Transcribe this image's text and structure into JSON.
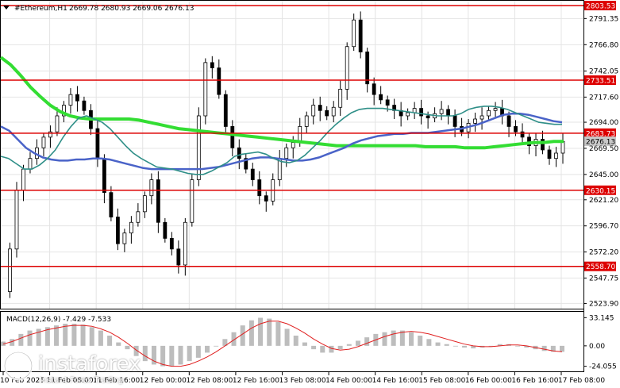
{
  "header": {
    "symbol": "#Ethereum,H1",
    "ohlc": "2669.78 2680.93 2669.06 2676.13"
  },
  "macd": {
    "label": "MACD(12,26,9) -7.429 -7.533",
    "ticks": [
      "33.145",
      "0.00",
      "-24.055"
    ],
    "tick_values": [
      33.145,
      0.0,
      -24.055
    ],
    "range": [
      -30,
      40
    ]
  },
  "watermark": {
    "brand": "instaforex",
    "tagline": "Instant Forex Trading"
  },
  "colors": {
    "ma_fast": "#2f8f88",
    "ma_mid": "#4a63c8",
    "ma_slow": "#33dd33",
    "level_line": "#dd0000",
    "level_tag": "#dd0000",
    "price_tag": "#c8c8c8",
    "macd_hist": "#bdbdbd",
    "macd_signal": "#e02020"
  },
  "chart_data": {
    "type": "line",
    "series_kind": "candlestick price chart with moving averages",
    "y_ticks": [
      "2791.35",
      "2766.80",
      "2742.05",
      "2717.60",
      "2694.00",
      "2669.50",
      "2645.00",
      "2621.20",
      "2596.70",
      "2572.20",
      "2547.75",
      "2523.90"
    ],
    "y_tick_values": [
      2791.35,
      2766.8,
      2742.05,
      2717.6,
      2694.0,
      2669.5,
      2645.0,
      2621.2,
      2596.7,
      2572.2,
      2547.75,
      2523.9
    ],
    "ylim": [
      2519,
      2808
    ],
    "x_labels": [
      "10 Feb 2025",
      "11 Feb 08:00",
      "11 Feb 16:00",
      "12 Feb 00:00",
      "12 Feb 08:00",
      "12 Feb 16:00",
      "13 Feb 08:00",
      "14 Feb 00:00",
      "14 Feb 16:00",
      "15 Feb 08:00",
      "16 Feb 00:00",
      "16 Feb 16:00",
      "17 Feb 08:00"
    ],
    "levels": [
      {
        "label": "2803.53",
        "value": 2803.53
      },
      {
        "label": "2733.51",
        "value": 2733.51
      },
      {
        "label": "2683.73",
        "value": 2683.73
      },
      {
        "label": "2630.15",
        "value": 2630.15
      },
      {
        "label": "2558.70",
        "value": 2558.7
      }
    ],
    "current_price": {
      "label": "2676.13",
      "value": 2676.13
    },
    "price_path": [
      2535,
      2575,
      2630,
      2650,
      2660,
      2670,
      2680,
      2685,
      2700,
      2710,
      2720,
      2714,
      2705,
      2688,
      2660,
      2628,
      2605,
      2580,
      2590,
      2600,
      2610,
      2625,
      2640,
      2600,
      2585,
      2575,
      2560,
      2600,
      2640,
      2700,
      2750,
      2745,
      2720,
      2690,
      2670,
      2660,
      2650,
      2640,
      2625,
      2620,
      2640,
      2660,
      2670,
      2675,
      2690,
      2700,
      2710,
      2705,
      2700,
      2708,
      2725,
      2765,
      2790,
      2760,
      2730,
      2720,
      2715,
      2710,
      2705,
      2700,
      2703,
      2707,
      2700,
      2698,
      2702,
      2706,
      2700,
      2690,
      2685,
      2693,
      2697,
      2700,
      2705,
      2707,
      2700,
      2690,
      2685,
      2680,
      2672,
      2678,
      2668,
      2660,
      2665,
      2676
    ],
    "ma_fast": [
      2662,
      2660,
      2655,
      2650,
      2650,
      2654,
      2660,
      2668,
      2680,
      2690,
      2698,
      2700,
      2697,
      2694,
      2688,
      2680,
      2672,
      2665,
      2660,
      2656,
      2652,
      2651,
      2650,
      2648,
      2646,
      2645,
      2645,
      2648,
      2652,
      2656,
      2662,
      2664,
      2665,
      2666,
      2664,
      2660,
      2657,
      2656,
      2658,
      2663,
      2670,
      2677,
      2685,
      2692,
      2698,
      2703,
      2706,
      2707,
      2707,
      2707,
      2706,
      2705,
      2704,
      2703,
      2702,
      2701,
      2700,
      2700,
      2700,
      2702,
      2706,
      2708,
      2709,
      2709,
      2708,
      2706,
      2703,
      2700,
      2697,
      2694,
      2693,
      2692,
      2692
    ],
    "ma_mid": [
      2690,
      2686,
      2678,
      2670,
      2665,
      2661,
      2659,
      2658,
      2658,
      2659,
      2659,
      2660,
      2660,
      2659,
      2657,
      2655,
      2653,
      2651,
      2650,
      2650,
      2650,
      2650,
      2650,
      2650,
      2650,
      2651,
      2652,
      2654,
      2656,
      2658,
      2660,
      2661,
      2661,
      2660,
      2659,
      2658,
      2658,
      2659,
      2661,
      2664,
      2667,
      2670,
      2674,
      2677,
      2679,
      2681,
      2682,
      2683,
      2683,
      2684,
      2684,
      2684,
      2685,
      2686,
      2687,
      2688,
      2690,
      2692,
      2695,
      2698,
      2701,
      2702,
      2702,
      2701,
      2699,
      2697,
      2695,
      2694
    ],
    "ma_slow": [
      2755,
      2748,
      2738,
      2727,
      2718,
      2710,
      2704,
      2700,
      2698,
      2697,
      2697,
      2697,
      2697,
      2697,
      2696,
      2694,
      2692,
      2690,
      2688,
      2687,
      2686,
      2685,
      2684,
      2683,
      2682,
      2681,
      2680,
      2679,
      2678,
      2677,
      2676,
      2675,
      2674,
      2673,
      2672,
      2672,
      2672,
      2672,
      2672,
      2672,
      2672,
      2672,
      2672,
      2671,
      2671,
      2671,
      2671,
      2670,
      2670,
      2670,
      2671,
      2672,
      2673,
      2674,
      2675,
      2675,
      2676,
      2676
    ],
    "macd_hist": [
      5,
      8,
      14,
      18,
      20,
      22,
      24,
      26,
      26,
      25,
      22,
      18,
      12,
      4,
      -4,
      -12,
      -18,
      -22,
      -24,
      -24,
      -22,
      -18,
      -14,
      -8,
      0,
      8,
      16,
      24,
      30,
      33,
      32,
      28,
      20,
      12,
      4,
      -4,
      -8,
      -8,
      -4,
      2,
      6,
      10,
      14,
      16,
      18,
      18,
      16,
      12,
      8,
      4,
      2,
      0,
      -2,
      -3,
      -2,
      0,
      2,
      2,
      0,
      -2,
      -4,
      -6,
      -7,
      -7
    ],
    "macd_signal": [
      2,
      5,
      9,
      13,
      16,
      19,
      21,
      23,
      24,
      24,
      23,
      20,
      16,
      10,
      3,
      -5,
      -12,
      -18,
      -22,
      -24,
      -24,
      -22,
      -18,
      -13,
      -7,
      0,
      7,
      14,
      21,
      26,
      29,
      29,
      26,
      21,
      15,
      8,
      2,
      -3,
      -5,
      -4,
      -1,
      3,
      7,
      11,
      14,
      16,
      17,
      16,
      14,
      11,
      8,
      5,
      2,
      0,
      -1,
      -1,
      0,
      1,
      1,
      0,
      -2,
      -4,
      -6,
      -7
    ]
  }
}
